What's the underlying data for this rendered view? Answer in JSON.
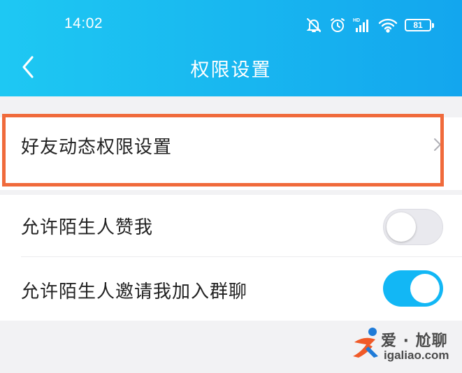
{
  "status_bar": {
    "time": "14:02",
    "battery": "81",
    "icons": [
      "bell-off-icon",
      "alarm-icon",
      "hd-signal-icon",
      "wifi-icon",
      "battery-icon"
    ]
  },
  "header": {
    "title": "权限设置",
    "back_icon": "chevron-left-icon",
    "gradient_start": "#1ec8f3",
    "gradient_end": "#13a6ee"
  },
  "settings": {
    "friend_moments": {
      "label": "好友动态权限设置",
      "icon": "chevron-right-icon",
      "highlight_color": "#f06a3b"
    },
    "allow_stranger_likes": {
      "label": "允许陌生人赞我",
      "enabled": false
    },
    "allow_stranger_group_invite": {
      "label": "允许陌生人邀请我加入群聊",
      "enabled": true,
      "accent": "#12b7f5"
    }
  },
  "watermark": {
    "text": "爱 · 尬聊",
    "url": "igaliao.com"
  }
}
